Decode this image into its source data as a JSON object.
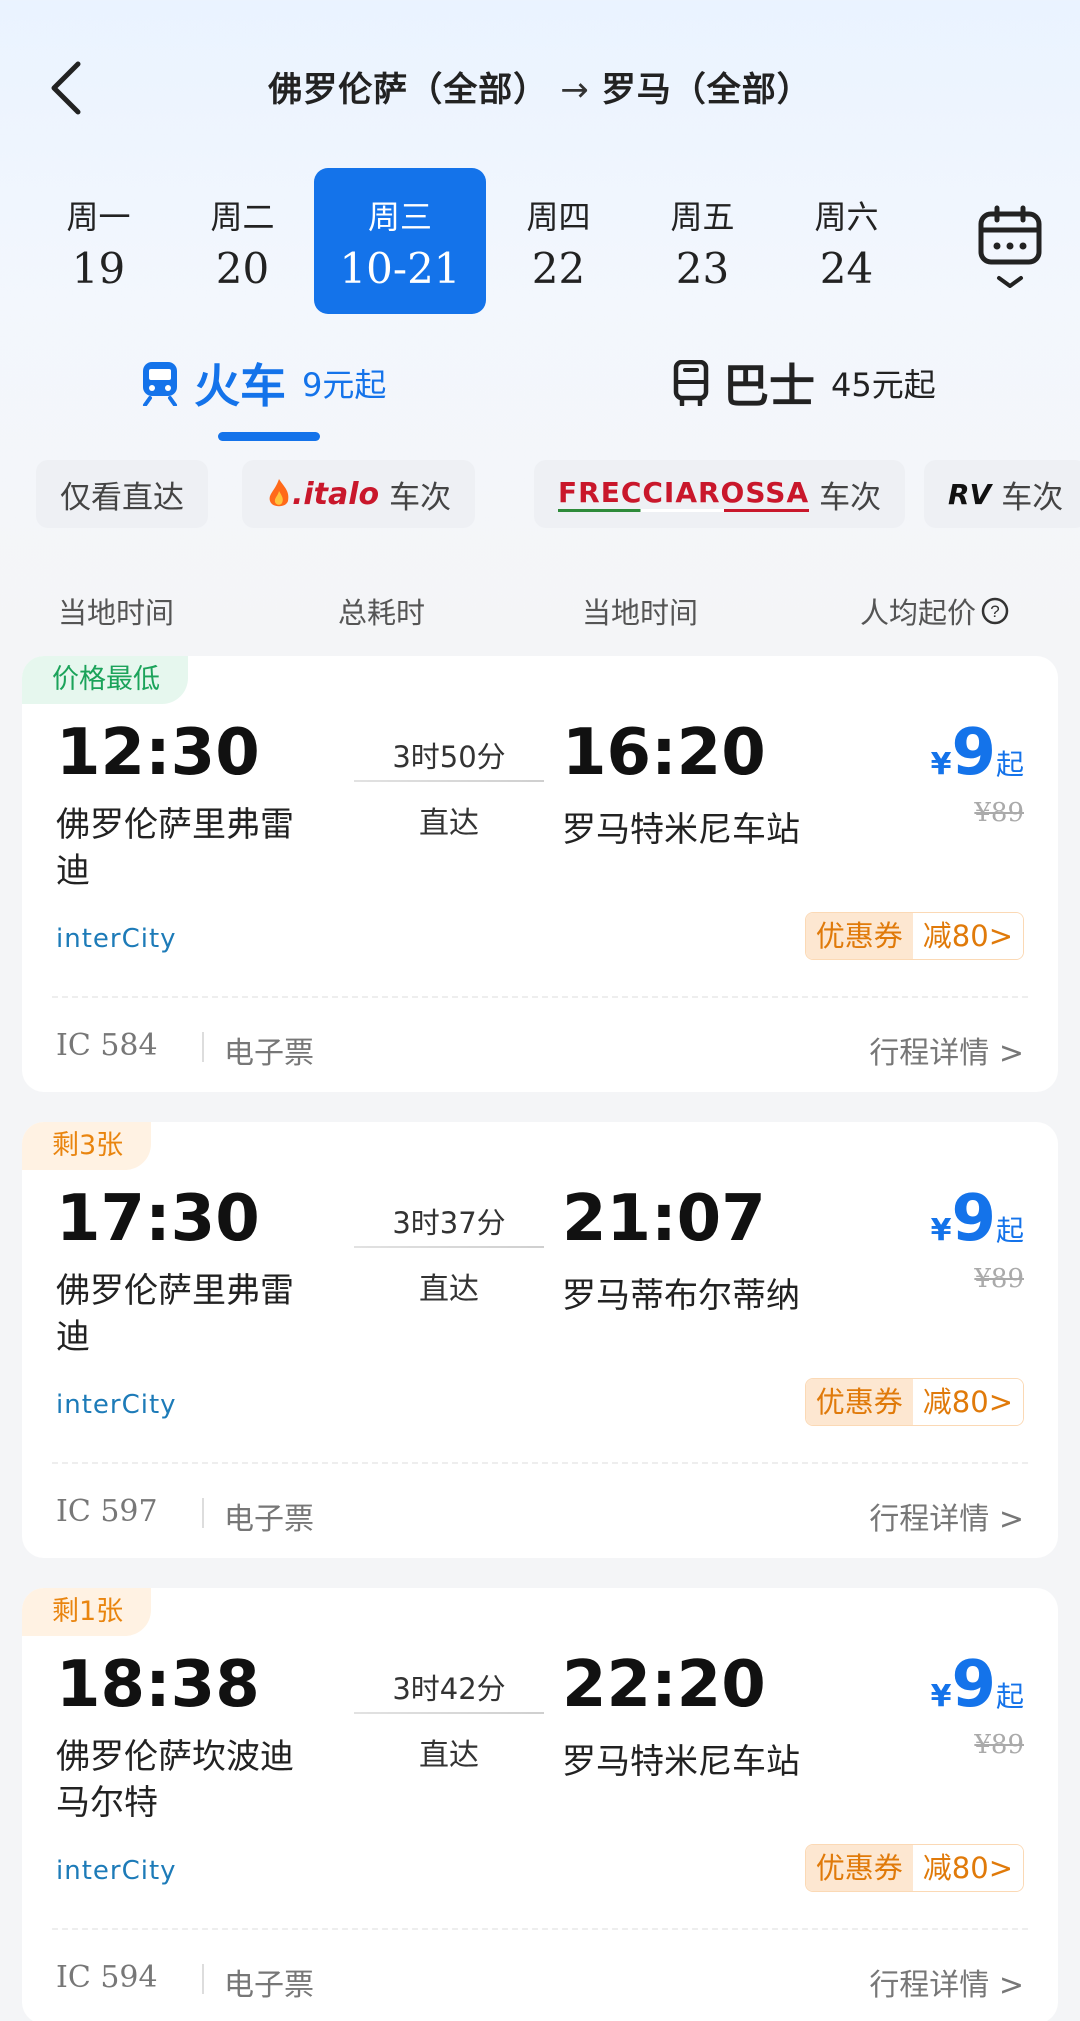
{
  "header": {
    "from": "佛罗伦萨（全部）",
    "arrow": "→",
    "to": "罗马（全部）"
  },
  "days": [
    {
      "weekday": "周一",
      "date": "19"
    },
    {
      "weekday": "周二",
      "date": "20"
    },
    {
      "weekday": "周三",
      "date": "10-21"
    },
    {
      "weekday": "周四",
      "date": "22"
    },
    {
      "weekday": "周五",
      "date": "23"
    },
    {
      "weekday": "周六",
      "date": "24"
    }
  ],
  "modes": {
    "train": {
      "label": "火车",
      "price": "9元起"
    },
    "bus": {
      "label": "巴士",
      "price": "45元起"
    }
  },
  "filters": {
    "direct": "仅看直达",
    "italo": ".italo",
    "frecciarossa": "FRECCIAROSSA",
    "rv": "RV",
    "suffix": "车次"
  },
  "columns": {
    "dep": "当地时间",
    "duration": "总耗时",
    "arr": "当地时间",
    "price": "人均起价"
  },
  "trains": [
    {
      "tag": "价格最低",
      "dep_time": "12:30",
      "dep_station": "佛罗伦萨里弗雷迪",
      "duration": "3时50分",
      "direct": "直达",
      "arr_time": "16:20",
      "arr_station": "罗马特米尼车站",
      "currency": "¥",
      "price": "9",
      "from": "起",
      "orig_price": "¥89",
      "operator": "interCity",
      "coupon": "优惠券",
      "coupon_value": "减80>",
      "train_no": "IC  584",
      "eticket": "电子票",
      "detail": "行程详情 >"
    },
    {
      "tag": "剩3张",
      "dep_time": "17:30",
      "dep_station": "佛罗伦萨里弗雷迪",
      "duration": "3时37分",
      "direct": "直达",
      "arr_time": "21:07",
      "arr_station": "罗马蒂布尔蒂纳",
      "currency": "¥",
      "price": "9",
      "from": "起",
      "orig_price": "¥89",
      "operator": "interCity",
      "coupon": "优惠券",
      "coupon_value": "减80>",
      "train_no": "IC  597",
      "eticket": "电子票",
      "detail": "行程详情 >"
    },
    {
      "tag": "剩1张",
      "dep_time": "18:38",
      "dep_station": "佛罗伦萨坎波迪马尔特",
      "duration": "3时42分",
      "direct": "直达",
      "arr_time": "22:20",
      "arr_station": "罗马特米尼车站",
      "currency": "¥",
      "price": "9",
      "from": "起",
      "orig_price": "¥89",
      "operator": "interCity",
      "coupon": "优惠券",
      "coupon_value": "减80>",
      "train_no": "IC  594",
      "eticket": "电子票",
      "detail": "行程详情 >"
    }
  ]
}
